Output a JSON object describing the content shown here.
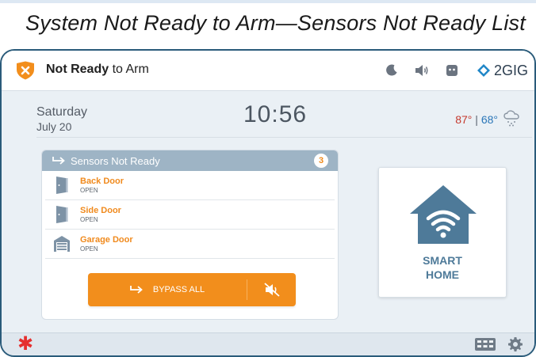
{
  "caption": "System Not Ready to Arm—Sensors Not Ready List",
  "header": {
    "status_bold": "Not Ready",
    "status_rest": " to Arm",
    "brand": "2GIG",
    "icons": [
      "shield-x-icon",
      "moon-icon",
      "speaker-icon",
      "chat-bubble-icon",
      "brand-logo-icon"
    ]
  },
  "datetime": {
    "day": "Saturday",
    "date": "July 20",
    "time": "10:56"
  },
  "weather": {
    "high": "87°",
    "separator": " | ",
    "low": "68°",
    "icon": "cloud-snow-icon"
  },
  "sensors": {
    "title": "Sensors Not Ready",
    "count": "3",
    "items": [
      {
        "name": "Back Door",
        "status": "OPEN",
        "icon": "door-icon"
      },
      {
        "name": "Side Door",
        "status": "OPEN",
        "icon": "door-icon"
      },
      {
        "name": "Garage Door",
        "status": "OPEN",
        "icon": "garage-icon"
      }
    ],
    "bypass_label": "BYPASS ALL"
  },
  "smart_home": {
    "label_line1": "SMART",
    "label_line2": "HOME"
  },
  "colors": {
    "accent_orange": "#F28E1C",
    "alert_red": "#E5302F",
    "panel_header": "#9EB4C5",
    "smart_blue": "#4E7A99"
  }
}
